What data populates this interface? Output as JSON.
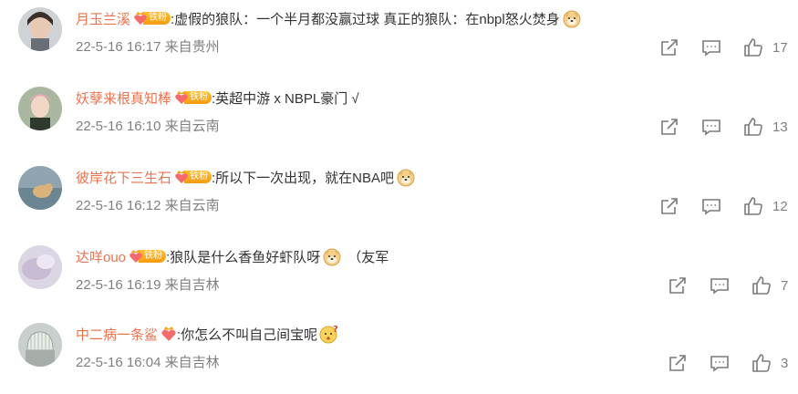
{
  "comments": [
    {
      "username": "月玉兰溪",
      "badge": "铁粉",
      "text": ":虚假的狼队：一个半月都没赢过球  真正的狼队：在nbpl怒火焚身",
      "trail_text": "",
      "emoji": "doge-emoji",
      "timestamp": "22-5-16 16:17 来自贵州",
      "likes": "17"
    },
    {
      "username": "妖孽来根真知棒",
      "badge": "铁粉",
      "text": ":英超中游 x NBPL豪门 √",
      "trail_text": "",
      "emoji": "",
      "timestamp": "22-5-16 16:10 来自云南",
      "likes": "13"
    },
    {
      "username": "彼岸花下三生石",
      "badge": "铁粉",
      "text": ":所以下一次出现，就在NBA吧",
      "trail_text": "",
      "emoji": "doge-emoji",
      "timestamp": "22-5-16 16:12 来自云南",
      "likes": "12"
    },
    {
      "username": "达咩ouo",
      "badge": "铁粉",
      "text": ":狼队是什么香鱼好虾队呀",
      "trail_text": "（友军",
      "emoji": "doge-emoji",
      "timestamp": "22-5-16 16:19 来自吉林",
      "likes": "7"
    },
    {
      "username": "中二病一条鲨",
      "badge": "",
      "text": ":你怎么不叫自己间宝呢",
      "trail_text": "",
      "emoji": "question-emoji",
      "timestamp": "22-5-16 16:04 来自吉林",
      "likes": "3"
    }
  ],
  "colors": {
    "username": "#eb7350",
    "meta": "#808080",
    "badge": "#f7a21b"
  },
  "icons": [
    "share-icon",
    "comment-icon",
    "like-icon"
  ]
}
